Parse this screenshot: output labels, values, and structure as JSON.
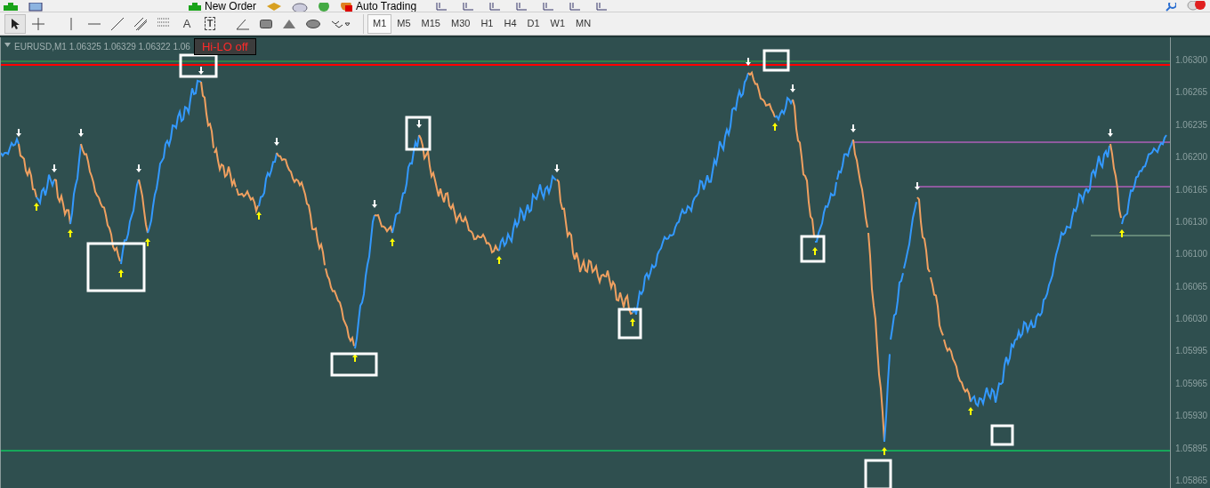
{
  "top_toolbar": {
    "buttons": [
      {
        "kind": "new-order",
        "label": "New Order"
      },
      {
        "kind": "auto-trading",
        "label": "Auto Trading"
      }
    ]
  },
  "drawing_toolbar": {
    "tools": [
      {
        "kind": "cursor",
        "selected": true
      },
      {
        "kind": "crosshair",
        "selected": false
      },
      {
        "kind": "vline",
        "selected": false
      },
      {
        "kind": "hline",
        "selected": false
      },
      {
        "kind": "trend",
        "selected": false
      },
      {
        "kind": "channel",
        "selected": false
      },
      {
        "kind": "fibo",
        "selected": false
      },
      {
        "kind": "text",
        "label": "A",
        "selected": false
      },
      {
        "kind": "label",
        "label": "T",
        "selected": false
      },
      {
        "kind": "angle",
        "selected": false
      },
      {
        "kind": "rect",
        "selected": false
      },
      {
        "kind": "triangle",
        "selected": false
      },
      {
        "kind": "ellipse",
        "selected": false
      },
      {
        "kind": "arrows",
        "selected": false
      }
    ]
  },
  "timeframes": [
    {
      "label": "M1",
      "selected": true
    },
    {
      "label": "M5",
      "selected": false
    },
    {
      "label": "M15",
      "selected": false
    },
    {
      "label": "M30",
      "selected": false
    },
    {
      "label": "H1",
      "selected": false
    },
    {
      "label": "H4",
      "selected": false
    },
    {
      "label": "D1",
      "selected": false
    },
    {
      "label": "W1",
      "selected": false
    },
    {
      "label": "MN",
      "selected": false
    }
  ],
  "chart": {
    "header": "EURUSD,M1  1.06325 1.06329 1.06322 1.06",
    "hilo_button": "Hi-LO off",
    "price_axis": [
      "1.06300",
      "1.06265",
      "1.06235",
      "1.06200",
      "1.06165",
      "1.06130",
      "1.06100",
      "1.06065",
      "1.06030",
      "1.05995",
      "1.05965",
      "1.05930",
      "1.05895",
      "1.05865"
    ]
  }
}
